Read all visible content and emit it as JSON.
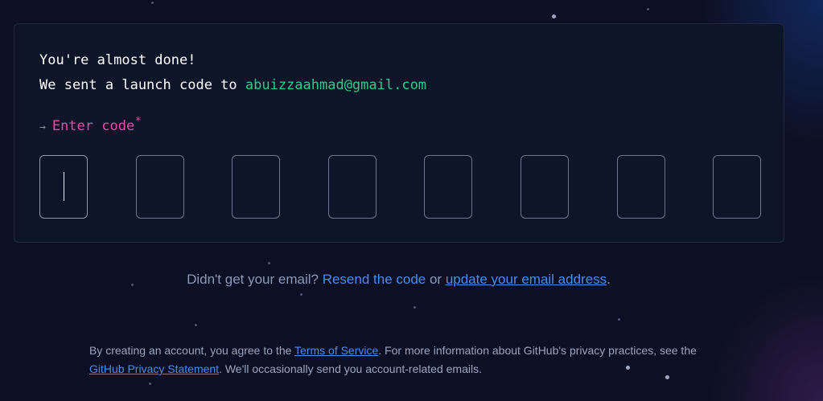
{
  "card": {
    "line1": "You're almost done!",
    "line2_prefix": "We sent a launch code to ",
    "email": "abuizzaahmad@gmail.com",
    "arrow": "→",
    "enter_label": "Enter code",
    "required_mark": "*",
    "code_digits": [
      "",
      "",
      "",
      "",
      "",
      "",
      "",
      ""
    ]
  },
  "resend": {
    "prefix": "Didn't get your email? ",
    "resend_link": "Resend the code",
    "middle": " or ",
    "update_link": "update your email address",
    "suffix": "."
  },
  "legal": {
    "part1": "By creating an account, you agree to the ",
    "terms_link": "Terms of Service",
    "part2": ". For more information about GitHub's privacy practices, see the ",
    "privacy_link": "GitHub Privacy Statement",
    "part3": ". We'll occasionally send you account-related emails."
  },
  "colors": {
    "background": "#0d1024",
    "card_bg": "#0e1528",
    "email": "#2ecc8a",
    "accent_pink": "#ea4aaa",
    "link": "#4a8cf0"
  }
}
